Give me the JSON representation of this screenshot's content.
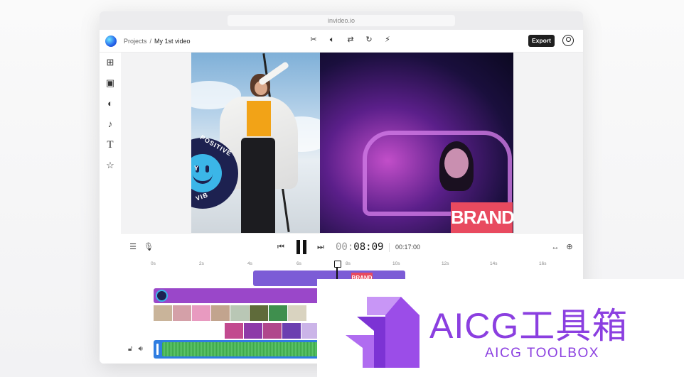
{
  "browser": {
    "url": "invideo.io"
  },
  "header": {
    "crumb_root": "Projects",
    "crumb_sep": "/",
    "project_name": "My 1st video",
    "export_label": "Export",
    "tools": [
      "scissors-icon",
      "volume-icon",
      "swap-icon",
      "rotate-icon",
      "magic-wand-icon"
    ]
  },
  "sidebar": {
    "items": [
      "layout-icon",
      "media-icon",
      "shapes-icon",
      "music-icon",
      "text-icon",
      "star-icon"
    ]
  },
  "canvas": {
    "badge_text_top": "POSITIVE",
    "badge_text_bottom": "VIB",
    "badge_text_left": "Y",
    "brand_text": "BRAND"
  },
  "playback": {
    "time_dim": "00:",
    "time_current": "08:09",
    "total_time": "00:17:00"
  },
  "timeline": {
    "ticks": [
      "0s",
      "2s",
      "4s",
      "6s",
      "8s",
      "10s",
      "12s",
      "14s",
      "16s"
    ],
    "brand_clip_label": "BRAND"
  },
  "watermark": {
    "title": "AICG工具箱",
    "subtitle": "AICG TOOLBOX"
  },
  "colors": {
    "accent": "#8b3fe0",
    "brand_red": "#e84a5f",
    "track_purple": "#9a47c9",
    "track_violet": "#7c5cd6",
    "audio_blue": "#2f7de1"
  }
}
